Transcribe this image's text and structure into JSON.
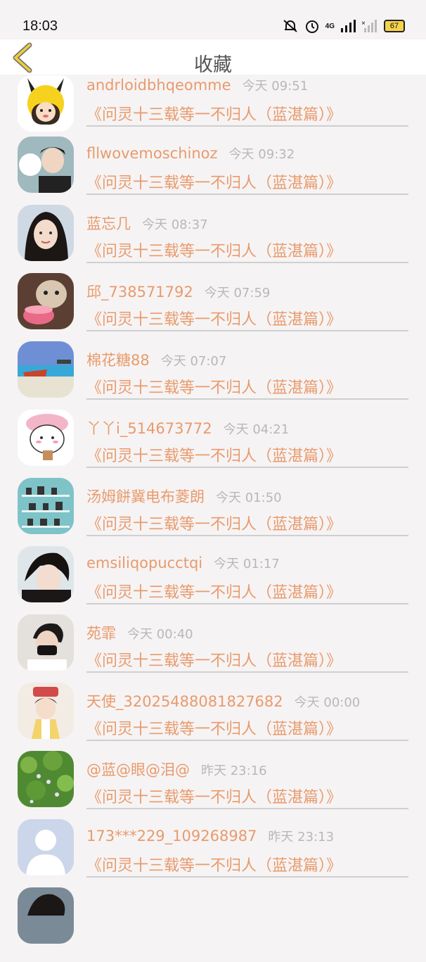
{
  "status": {
    "time": "18:03",
    "network": "4G",
    "battery": "67"
  },
  "header": {
    "title": "收藏"
  },
  "favorites": [
    {
      "user": "andrloidbhqeomme",
      "time": "今天 09:51",
      "book": "《问灵十三载等一不归人（蓝湛篇）》"
    },
    {
      "user": "fllwovemoschinoz",
      "time": "今天 09:32",
      "book": "《问灵十三载等一不归人（蓝湛篇）》"
    },
    {
      "user": "蓝忘几",
      "time": "今天 08:37",
      "book": "《问灵十三载等一不归人（蓝湛篇）》"
    },
    {
      "user": "邱_738571792",
      "time": "今天 07:59",
      "book": "《问灵十三载等一不归人（蓝湛篇）》"
    },
    {
      "user": "棉花糖88",
      "time": "今天 07:07",
      "book": "《问灵十三载等一不归人（蓝湛篇）》"
    },
    {
      "user": "丫丫i_514673772",
      "time": "今天 04:21",
      "book": "《问灵十三载等一不归人（蓝湛篇）》"
    },
    {
      "user": "汤姆餅冀电布菱朗",
      "time": "今天 01:50",
      "book": "《问灵十三载等一不归人（蓝湛篇）》"
    },
    {
      "user": "emsiliqopucctqi",
      "time": "今天 01:17",
      "book": "《问灵十三载等一不归人（蓝湛篇）》"
    },
    {
      "user": "苑霏",
      "time": "今天 00:40",
      "book": "《问灵十三载等一不归人（蓝湛篇）》"
    },
    {
      "user": "天使_32025488081827682",
      "time": "今天 00:00",
      "book": "《问灵十三载等一不归人（蓝湛篇）》"
    },
    {
      "user": "@蓝@眼@泪@",
      "time": "昨天 23:16",
      "book": "《问灵十三载等一不归人（蓝湛篇）》"
    },
    {
      "user": "173***229_109268987",
      "time": "昨天 23:13",
      "book": "《问灵十三载等一不归人（蓝湛篇）》"
    }
  ],
  "colors": {
    "accent": "#e89b6c",
    "timestamp": "#b8b8b8",
    "background": "#f6f3f4"
  }
}
